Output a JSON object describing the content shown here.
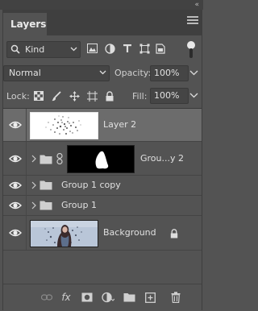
{
  "panel": {
    "title": "Layers"
  },
  "filter": {
    "kind_label": "Kind",
    "icons": [
      "image-filter-icon",
      "adjustment-filter-icon",
      "type-filter-icon",
      "shape-filter-icon",
      "smart-object-filter-icon"
    ]
  },
  "blend": {
    "mode": "Normal",
    "opacity_label": "Opacity:",
    "opacity_value": "100%"
  },
  "lock": {
    "label": "Lock:",
    "fill_label": "Fill:",
    "fill_value": "100%"
  },
  "layers": [
    {
      "name": "Layer 2",
      "selected": true
    },
    {
      "name": "Grou...y 2",
      "type": "group-with-mask"
    },
    {
      "name": "Group 1 copy",
      "type": "group"
    },
    {
      "name": "Group 1",
      "type": "group"
    },
    {
      "name": "Background",
      "locked": true
    }
  ],
  "bottom": {
    "fx_label": "fx"
  },
  "colors": {
    "panel_bg": "#535353",
    "selected_row": "#6c6c6c",
    "tab_bar": "#3f3f3f"
  }
}
